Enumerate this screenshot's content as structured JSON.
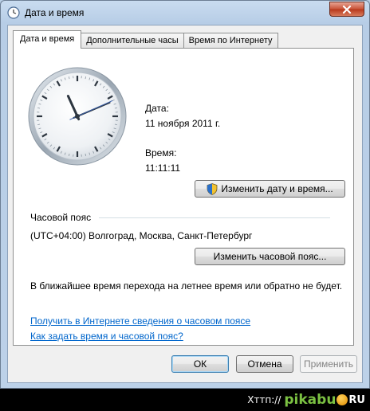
{
  "window": {
    "title": "Дата и время",
    "icon": "clock-icon"
  },
  "tabs": [
    {
      "label": "Дата и время",
      "active": true
    },
    {
      "label": "Дополнительные часы",
      "active": false
    },
    {
      "label": "Время по Интернету",
      "active": false
    }
  ],
  "date_section": {
    "date_label": "Дата:",
    "date_value": "11 ноября 2011 г.",
    "time_label": "Время:",
    "time_value": "11:11:11",
    "change_datetime_button": "Изменить дату и время..."
  },
  "timezone_section": {
    "header": "Часовой пояс",
    "value": "(UTC+04:00) Волгоград, Москва, Санкт-Петербург",
    "change_timezone_button": "Изменить часовой пояс...",
    "dst_note": "В ближайшее время перехода на летнее время или обратно не будет."
  },
  "links": {
    "online_info": "Получить в Интернете сведения о часовом поясе",
    "how_to": "Как задать время и часовой пояс?"
  },
  "buttons": {
    "ok": "ОК",
    "cancel": "Отмена",
    "apply": "Применить"
  },
  "clock": {
    "hour": 11,
    "minute": 11,
    "second": 11
  },
  "watermark": {
    "prefix": "Xттп://",
    "brand": "pikabu",
    "tld": "RU"
  },
  "colors": {
    "link": "#0066cc",
    "close_button": "#c9553a",
    "uac_shield": "#2a6fc9"
  }
}
